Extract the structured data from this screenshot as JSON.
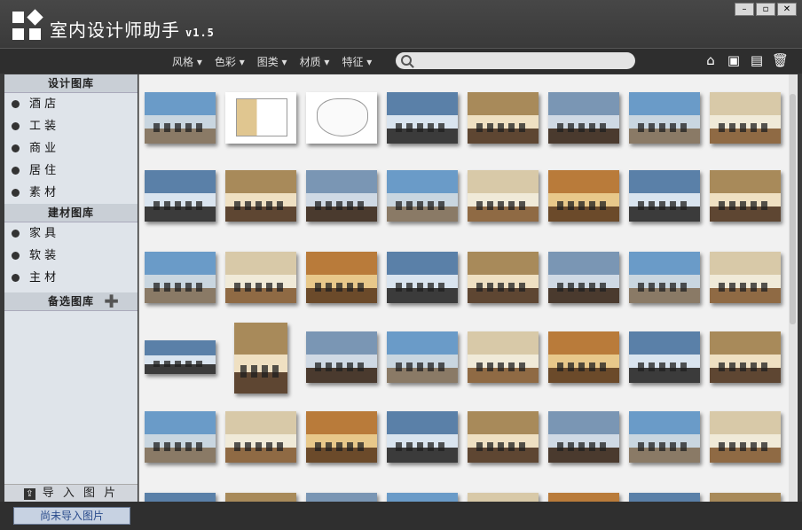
{
  "app": {
    "title": "室内设计师助手",
    "version": "v1.5"
  },
  "window_buttons": [
    "minimize-icon",
    "maximize-icon",
    "close-icon"
  ],
  "menu": [
    "风格",
    "色彩",
    "图类",
    "材质",
    "特征"
  ],
  "search": {
    "value": "",
    "placeholder": ""
  },
  "tools": [
    "home-icon",
    "save-icon",
    "print-icon",
    "trash-icon"
  ],
  "sidebar": {
    "design_title": "设计图库",
    "design_items": [
      "酒 店",
      "工 装",
      "商 业",
      "居 住",
      "素 材"
    ],
    "material_title": "建材图库",
    "material_items": [
      "家 具",
      "软 装",
      "主 材"
    ],
    "backup_title": "备选图库",
    "import_label": "导 入 图 片"
  },
  "status": {
    "button": "尚未导入图片"
  }
}
